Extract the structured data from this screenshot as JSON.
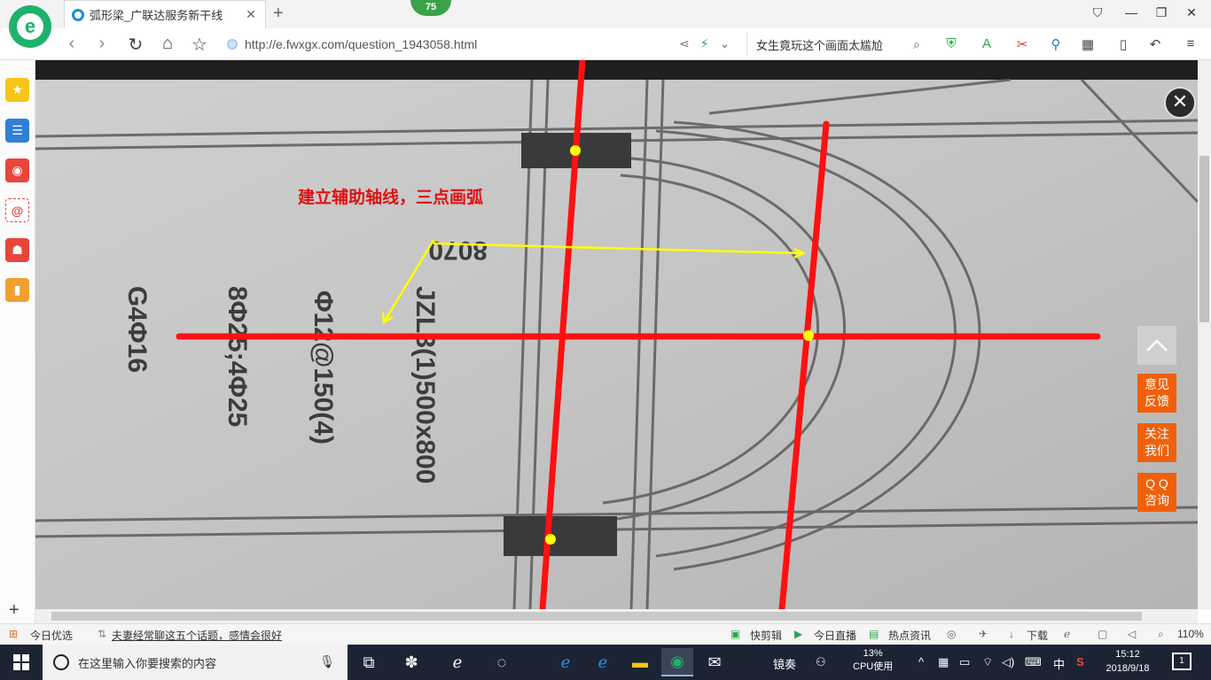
{
  "browser": {
    "tab_title": "弧形梁_广联达服务新干线",
    "weather_badge": "75",
    "address_url": "http://e.fwxgx.com/question_1943058.html",
    "search_text": "女生竟玩这个画面太尴尬"
  },
  "content": {
    "annotation_text": "建立辅助轴线，三点画弧",
    "photo_texts": [
      "JZL3(1)500x800",
      "Φ12@150(4)",
      "8Φ25;4Φ25",
      "G4Φ16",
      "8070"
    ],
    "float_buttons": [
      "意见\n反馈",
      "关注\n我们",
      "Q Q\n咨询"
    ]
  },
  "statusbar": {
    "today_picks": "今日优选",
    "headline": "夫妻经常聊这五个话题，感情会很好",
    "quick_cut": "快剪辑",
    "live": "今日直播",
    "hot_news": "热点资讯",
    "download": "下载",
    "zoom": "110%"
  },
  "taskbar": {
    "search_placeholder": "在这里输入你要搜索的内容",
    "cpu_percent": "13%",
    "cpu_label": "CPU使用",
    "ime": "中",
    "time": "15:12",
    "date": "2018/9/18",
    "notification_count": "1",
    "tray_text": "镜奏"
  },
  "colors": {
    "annotation_red": "#ff1010",
    "marker_yellow": "#ffff00",
    "float_orange": "#f0600a",
    "browser_green": "#1fb26b"
  }
}
